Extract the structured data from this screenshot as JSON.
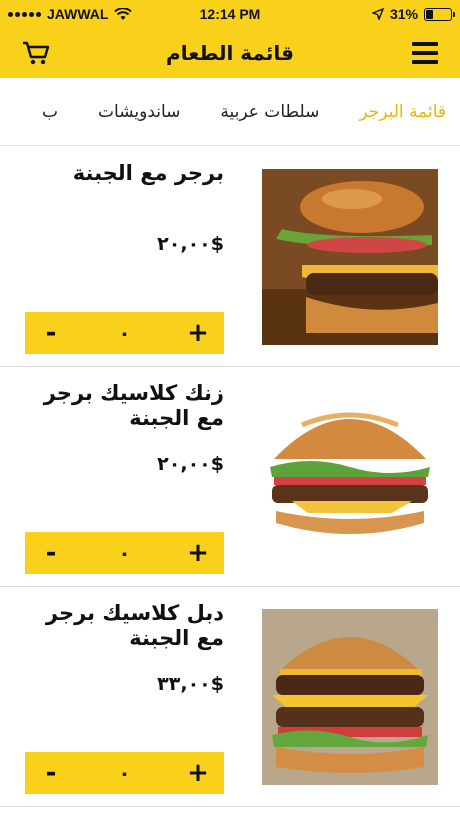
{
  "status_bar": {
    "carrier": "JAWWAL",
    "time": "12:14 PM",
    "battery": "31%",
    "battery_level": 0.31
  },
  "header": {
    "title": "قائمة الطعام",
    "cart_icon": "cart-icon",
    "menu_icon": "hamburger-icon",
    "color": "#f9d11a"
  },
  "tabs": [
    {
      "label": "قائمة البرجر",
      "active": true
    },
    {
      "label": "سلطات عربية",
      "active": false
    },
    {
      "label": "ساندويشات",
      "active": false
    },
    {
      "label": "ب",
      "active": false
    }
  ],
  "items": [
    {
      "name": "برجر مع الجبنة",
      "price": "$٢٠,٠٠",
      "qty": "٠",
      "minus": "-",
      "plus": "+"
    },
    {
      "name": "زنك كلاسيك برجر مع الجبنة",
      "price": "$٢٠,٠٠",
      "qty": "٠",
      "minus": "-",
      "plus": "+"
    },
    {
      "name": "دبل كلاسيك برجر مع الجبنة",
      "price": "$٣٣,٠٠",
      "qty": "٠",
      "minus": "-",
      "plus": "+"
    }
  ],
  "colors": {
    "accent": "#f9d11a",
    "active_tab": "#e8b80a"
  }
}
